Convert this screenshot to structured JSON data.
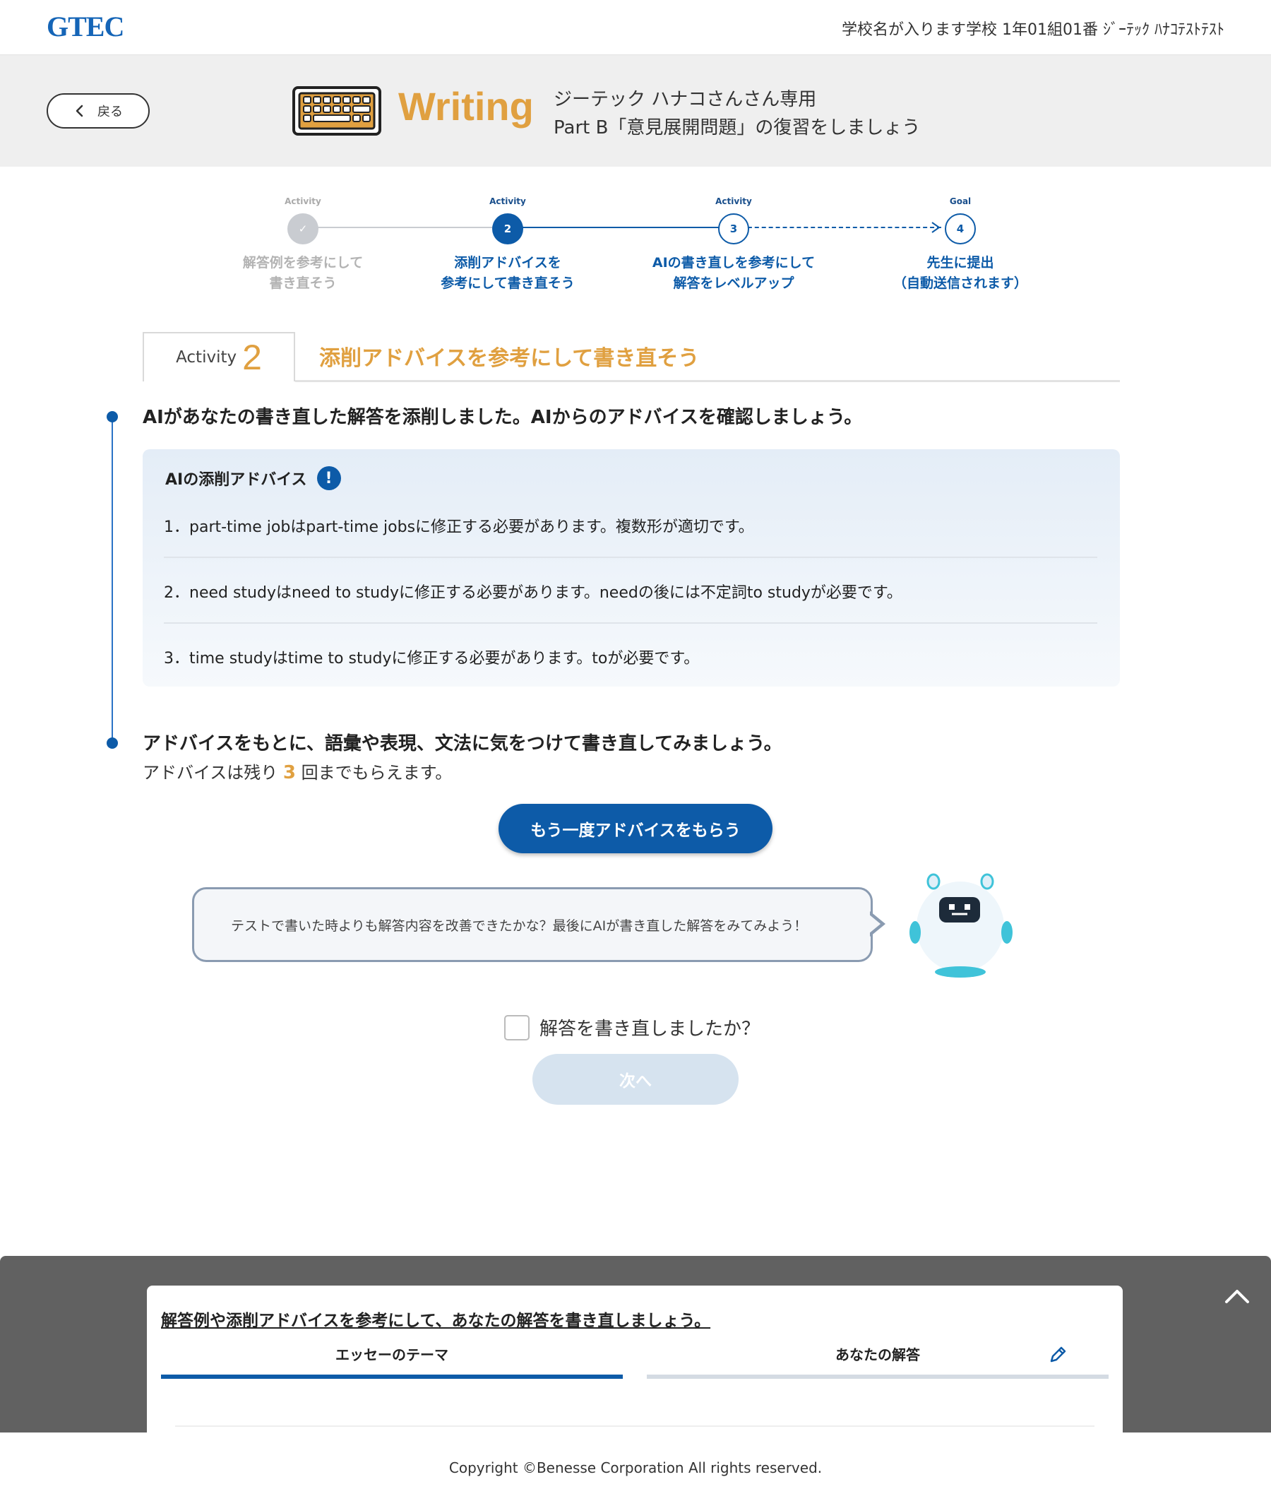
{
  "topbar": {
    "logo": "GTEC",
    "user_info": "学校名が入ります学校  1年01組01番  ｼﾞｰﾃｯｸ ﾊﾅｺﾃｽﾄﾃｽﾄ"
  },
  "header": {
    "back_label": "戻る",
    "title": "Writing",
    "subtitle1": "ジーテック ハナコさんさん専用",
    "subtitle2": "Part B「意見展開問題」の復習をしましょう"
  },
  "stepper": {
    "steps": [
      {
        "tag": "Activity",
        "number": "✓",
        "label1": "解答例を参考にして",
        "label2": "書き直そう",
        "state": "done"
      },
      {
        "tag": "Activity",
        "number": "2",
        "label1": "添削アドバイスを",
        "label2": "参考にして書き直そう",
        "state": "current"
      },
      {
        "tag": "Activity",
        "number": "3",
        "label1": "AIの書き直しを参考にして",
        "label2": "解答をレベルアップ",
        "state": "todo"
      },
      {
        "tag": "Goal",
        "number": "4",
        "label1": "先生に提出",
        "label2": "（自動送信されます）",
        "state": "todo"
      }
    ]
  },
  "activity": {
    "word": "Activity",
    "number": "2",
    "heading": "添削アドバイスを参考にして書き直そう"
  },
  "instruction1": "AIがあなたの書き直した解答を添削しました。AIからのアドバイスを確認しましょう。",
  "advice": {
    "title": "AIの添削アドバイス",
    "info_icon": "!",
    "items": [
      "1．part-time jobはpart-time jobsに修正する必要があります。複数形が適切です。",
      "2．need studyはneed to studyに修正する必要があります。needの後には不定詞to studyが必要です。",
      "3．time studyはtime to studyに修正する必要があります。toが必要です。"
    ]
  },
  "instruction2": "アドバイスをもとに、語彙や表現、文法に気をつけて書き直してみましょう。",
  "remaining": {
    "prefix": "アドバイスは残り",
    "count": "3",
    "suffix": "回までもらえます。"
  },
  "again_button": "もう一度アドバイスをもらう",
  "bubble_text": "テストで書いた時よりも解答内容を改善できたかな？最後にAIが書き直した解答をみてみよう！",
  "confirm": {
    "label": "解答を書き直しましたか？",
    "checked": false
  },
  "next_button": "次へ",
  "bottom_panel": {
    "link": "解答例や添削アドバイスを参考にして、あなたの解答を書き直しましょう。",
    "tabs": [
      {
        "label": "エッセーのテーマ",
        "active": true
      },
      {
        "label": "あなたの解答",
        "active": false
      }
    ]
  },
  "copyright": "Copyright ©Benesse Corporation All rights reserved.",
  "colors": {
    "primary": "#0d5ba8",
    "accent": "#e0a040",
    "disabled": "#d6e3ef",
    "panel_bg": "#616161"
  },
  "icons": [
    "chevron-left-icon",
    "keyboard-icon",
    "check-icon",
    "info-icon",
    "robot-mascot",
    "pencil-icon",
    "chevron-up-icon"
  ]
}
